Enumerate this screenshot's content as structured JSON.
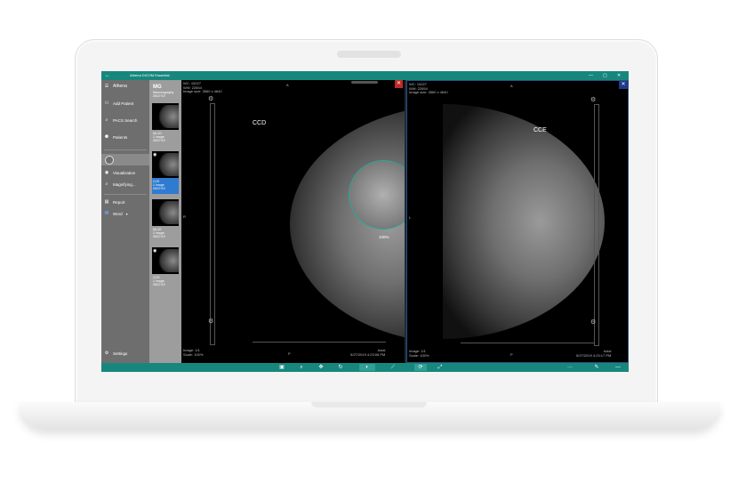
{
  "app": {
    "title": "Athena DICOM Essential",
    "back_glyph": "←",
    "window_controls": [
      "—",
      "▢",
      "✕"
    ]
  },
  "sidebar": {
    "brand": "Athena",
    "menu_glyph": "☰",
    "items": [
      {
        "icon": "person-icon",
        "glyph": "⚇",
        "label": "Add Patient"
      },
      {
        "icon": "search-icon",
        "glyph": "⌕",
        "label": "PACS Search"
      },
      {
        "icon": "patients-icon",
        "glyph": "⚈",
        "label": "Patients"
      },
      {
        "icon": "eye-icon",
        "glyph": "◉",
        "label": "Visualization"
      },
      {
        "icon": "magnify-icon",
        "glyph": "⌕",
        "label": "Magnifying..."
      },
      {
        "icon": "report-icon",
        "glyph": "▤",
        "label": "Report"
      },
      {
        "icon": "word-icon",
        "glyph": "W",
        "label": "Word"
      }
    ],
    "settings": {
      "icon": "gear-icon",
      "glyph": "⚙",
      "label": "Settings"
    }
  },
  "series_panel": {
    "modality": "MG",
    "modality_sub": "Mammography",
    "study_date": "05/27/19",
    "thumbs": [
      {
        "name": "MLCD",
        "count": "1 Image",
        "date": "05/27/19",
        "selected": false
      },
      {
        "name": "CCE",
        "count": "1 Image",
        "date": "05/27/19",
        "selected": true
      },
      {
        "name": "MLCE",
        "count": "1 Image",
        "date": "05/27/19",
        "selected": false
      },
      {
        "name": "CCD",
        "count": "1 Image",
        "date": "05/27/19",
        "selected": false
      }
    ]
  },
  "viewers": {
    "left": {
      "wc": "WC: 15227",
      "ww": "WW: 22654",
      "size": "Image size: 3560 x 4640",
      "label": "CCD",
      "orient_top": "A",
      "orient_bottom": "P",
      "orient_side": "R",
      "image_index": "Image: 1/1",
      "scale": "Scale: 100%",
      "plane": "Axial",
      "datetime": "5/27/2019 4:23:06 PM",
      "zoom": "100%"
    },
    "right": {
      "wc": "WC: 15227",
      "ww": "WW: 22654",
      "size": "Image size: 3560 x 4640",
      "label": "CCE",
      "orient_top": "A",
      "orient_bottom": "P",
      "orient_side": "L",
      "image_index": "Image: 1/1",
      "scale": "Scale: 100%",
      "plane": "Axial",
      "datetime": "5/27/2019 4:23:17 PM"
    }
  },
  "toolbar": {
    "tools": [
      {
        "icon": "layers-icon",
        "glyph": "▣"
      },
      {
        "icon": "zoom-icon",
        "glyph": "⌕"
      },
      {
        "icon": "pan-icon",
        "glyph": "✥"
      },
      {
        "icon": "rotate-icon",
        "glyph": "↻"
      },
      {
        "icon": "contrast-icon",
        "glyph": "◐"
      },
      {
        "icon": "measure-icon",
        "glyph": "⟋"
      },
      {
        "icon": "sync-icon",
        "glyph": "⟳"
      },
      {
        "icon": "fullscreen-icon",
        "glyph": "⤢"
      }
    ],
    "more": "···",
    "pen": "✎",
    "menu": "—"
  },
  "colors": {
    "accent": "#17877d",
    "sidebar": "#6e6e6e",
    "series": "#9d9d9d"
  }
}
